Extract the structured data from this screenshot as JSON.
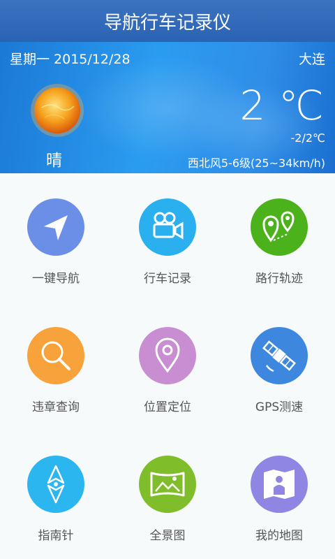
{
  "app": {
    "title": "导航行车记录仪"
  },
  "weather": {
    "date": "星期一 2015/12/28",
    "city": "大连",
    "condition": "晴",
    "temp": "2 ℃",
    "range": "-2/2℃",
    "wind": "西北风5-6级(25~34km/h)"
  },
  "menu": [
    {
      "label": "一键导航",
      "icon": "navigation-arrow-icon",
      "color": "#6b8fe6"
    },
    {
      "label": "行车记录",
      "icon": "video-camera-icon",
      "color": "#2ab0ee"
    },
    {
      "label": "路行轨迹",
      "icon": "route-track-icon",
      "color": "#4cb21c"
    },
    {
      "label": "违章查询",
      "icon": "search-icon",
      "color": "#f7a23a"
    },
    {
      "label": "位置定位",
      "icon": "location-pin-icon",
      "color": "#c98ed2"
    },
    {
      "label": "GPS测速",
      "icon": "satellite-icon",
      "color": "#3e87df"
    },
    {
      "label": "指南针",
      "icon": "compass-icon",
      "color": "#2bb6f0"
    },
    {
      "label": "全景图",
      "icon": "panorama-icon",
      "color": "#7fbe2a"
    },
    {
      "label": "我的地图",
      "icon": "my-map-icon",
      "color": "#8e86e2"
    }
  ]
}
